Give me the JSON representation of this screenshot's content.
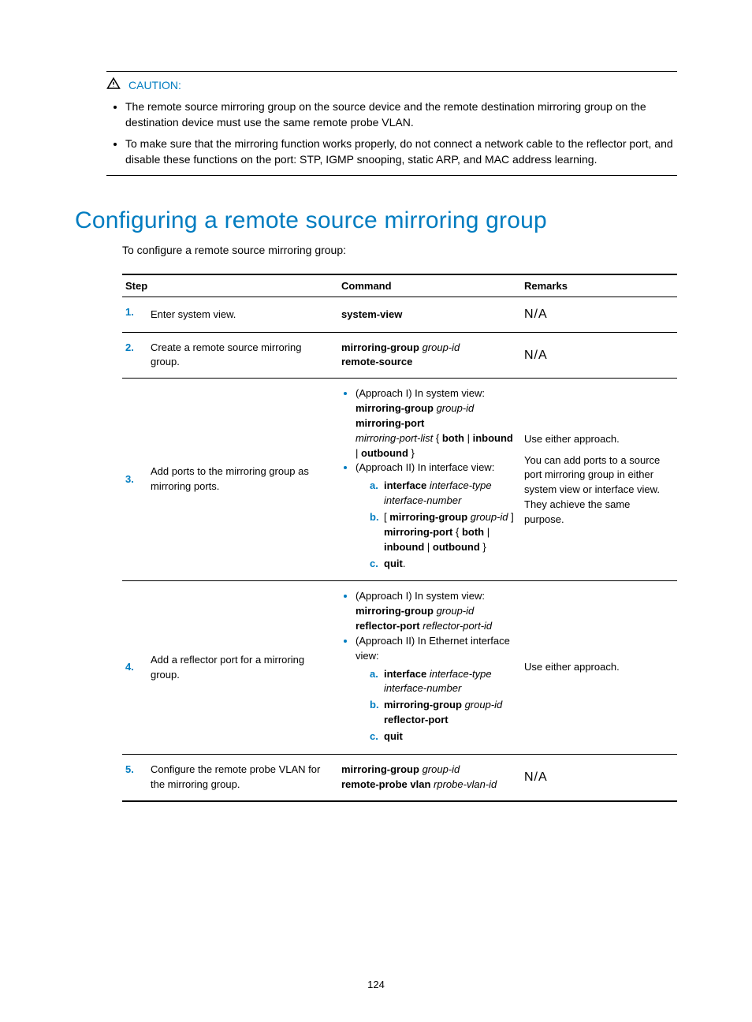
{
  "caution": {
    "label": "CAUTION:",
    "items": [
      "The remote source mirroring group on the source device and the remote destination mirroring group on the destination device must use the same remote probe VLAN.",
      "To make sure that the mirroring function works properly, do not connect a network cable to the reflector port, and disable these functions on the port: STP, IGMP snooping, static ARP, and MAC address learning."
    ]
  },
  "section": {
    "title": "Configuring a remote source mirroring group",
    "intro": "To configure a remote source mirroring group:"
  },
  "table": {
    "headers": {
      "step": "Step",
      "command": "Command",
      "remarks": "Remarks"
    },
    "rows": {
      "r1": {
        "num": "1.",
        "desc": "Enter system view.",
        "cmd": "system-view",
        "remarks": "N/A"
      },
      "r2": {
        "num": "2.",
        "desc": "Create a remote source mirroring group.",
        "cmd_bold1": "mirroring-group",
        "cmd_ital1": "group-id",
        "cmd_bold2": "remote-source",
        "remarks": "N/A"
      },
      "r3": {
        "num": "3.",
        "desc": "Add ports to the mirroring group as mirroring ports.",
        "approach1_label": "(Approach I) In system view:",
        "a1_bold1": "mirroring-group",
        "a1_ital1": "group-id",
        "a1_bold2": "mirroring-port",
        "a1_ital2": "mirroring-port-list",
        "a1_brace_open": " { ",
        "a1_both": "both",
        "a1_pipe1": " | ",
        "a1_inbound": "inbound",
        "a1_pipe2": " | ",
        "a1_outbound": "outbound",
        "a1_brace_close": " }",
        "approach2_label": "(Approach II) In interface view:",
        "a2_a_bold": "interface",
        "a2_a_ital": "interface-type interface-number",
        "a2_b_bracket_open": "[ ",
        "a2_b_bold1": "mirroring-group",
        "a2_b_ital1": "group-id",
        "a2_b_bracket_close": " ] ",
        "a2_b_bold2": "mirroring-port",
        "a2_b_brace_open": " { ",
        "a2_b_both": "both",
        "a2_b_pipe1": " | ",
        "a2_b_inbound": "inbound",
        "a2_b_pipe2": " | ",
        "a2_b_outbound": "outbound",
        "a2_b_brace_close": " }",
        "a2_c": "quit",
        "a2_c_suffix": ".",
        "marker_a": "a.",
        "marker_b": "b.",
        "marker_c": "c.",
        "remarks_line1": "Use either approach.",
        "remarks_line2": "You can add ports to a source port mirroring group in either system view or interface view. They achieve the same purpose."
      },
      "r4": {
        "num": "4.",
        "desc": "Add a reflector port for a mirroring group.",
        "approach1_label": "(Approach I) In system view:",
        "a1_bold1": "mirroring-group",
        "a1_ital1": "group-id",
        "a1_bold2": "reflector-port",
        "a1_ital2": "reflector-port-id",
        "approach2_label": "(Approach II) In Ethernet interface view:",
        "a2_a_bold": "interface",
        "a2_a_ital": "interface-type interface-number",
        "a2_b_bold1": "mirroring-group",
        "a2_b_ital1": "group-id",
        "a2_b_bold2": "reflector-port",
        "a2_c": "quit",
        "marker_a": "a.",
        "marker_b": "b.",
        "marker_c": "c.",
        "remarks": "Use either approach."
      },
      "r5": {
        "num": "5.",
        "desc": "Configure the remote probe VLAN for the mirroring group.",
        "cmd_bold1": "mirroring-group",
        "cmd_ital1": "group-id",
        "cmd_bold2": "remote-probe vlan",
        "cmd_ital2": "rprobe-vlan-id",
        "remarks": "N/A"
      }
    }
  },
  "page_number": "124"
}
